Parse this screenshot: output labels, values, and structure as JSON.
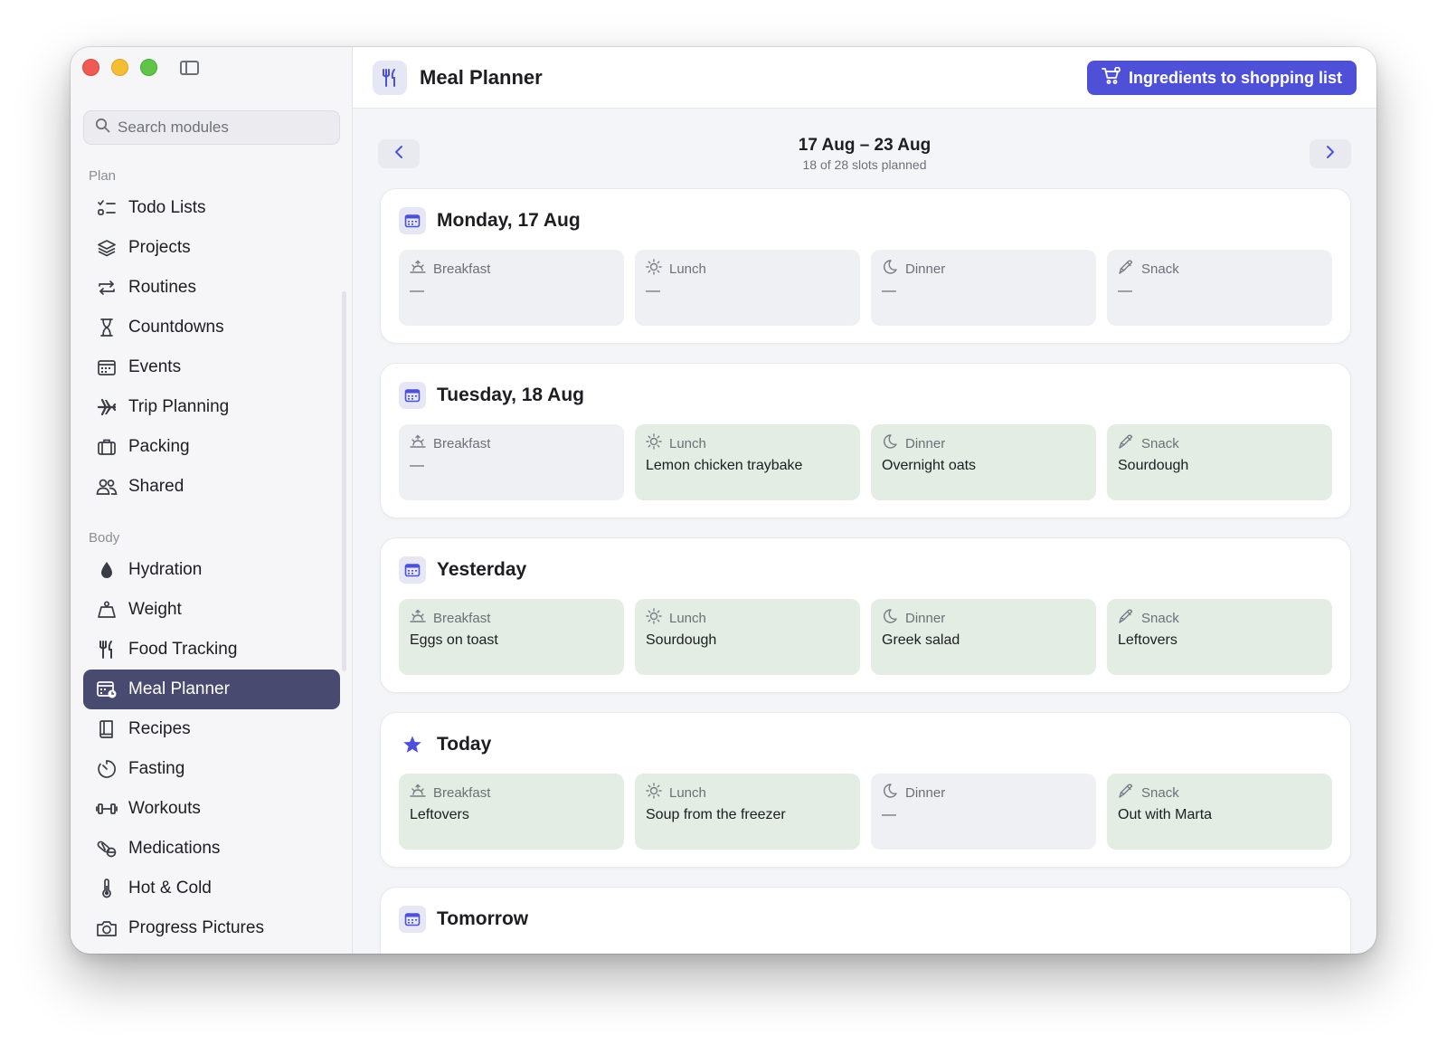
{
  "search": {
    "placeholder": "Search modules"
  },
  "sidebar": {
    "sections": [
      {
        "label": "Plan",
        "items": [
          {
            "label": "Todo Lists",
            "icon": "checklist-icon"
          },
          {
            "label": "Projects",
            "icon": "layers-icon"
          },
          {
            "label": "Routines",
            "icon": "repeat-icon"
          },
          {
            "label": "Countdowns",
            "icon": "hourglass-icon"
          },
          {
            "label": "Events",
            "icon": "calendar-icon"
          },
          {
            "label": "Trip Planning",
            "icon": "airplane-icon"
          },
          {
            "label": "Packing",
            "icon": "suitcase-icon"
          },
          {
            "label": "Shared",
            "icon": "people-icon"
          }
        ]
      },
      {
        "label": "Body",
        "items": [
          {
            "label": "Hydration",
            "icon": "droplet-icon"
          },
          {
            "label": "Weight",
            "icon": "scale-icon"
          },
          {
            "label": "Food Tracking",
            "icon": "fork-knife-icon"
          },
          {
            "label": "Meal Planner",
            "icon": "calendar-plan-icon",
            "active": true
          },
          {
            "label": "Recipes",
            "icon": "book-icon"
          },
          {
            "label": "Fasting",
            "icon": "timer-icon"
          },
          {
            "label": "Workouts",
            "icon": "dumbbell-icon"
          },
          {
            "label": "Medications",
            "icon": "pills-icon"
          },
          {
            "label": "Hot & Cold",
            "icon": "thermometer-icon"
          },
          {
            "label": "Progress Pictures",
            "icon": "camera-icon"
          }
        ]
      }
    ]
  },
  "header": {
    "title": "Meal Planner",
    "icon": "fork-knife-icon",
    "shopping_button": "Ingredients to shopping list"
  },
  "week": {
    "range": "17 Aug – 23 Aug",
    "summary": "18 of 28 slots planned"
  },
  "days": [
    {
      "title": "Monday, 17 Aug",
      "icon": "calendar-icon",
      "slots": [
        {
          "type": "Breakfast",
          "value": "—",
          "filled": false
        },
        {
          "type": "Lunch",
          "value": "—",
          "filled": false
        },
        {
          "type": "Dinner",
          "value": "—",
          "filled": false
        },
        {
          "type": "Snack",
          "value": "—",
          "filled": false
        }
      ]
    },
    {
      "title": "Tuesday, 18 Aug",
      "icon": "calendar-icon",
      "slots": [
        {
          "type": "Breakfast",
          "value": "—",
          "filled": false
        },
        {
          "type": "Lunch",
          "value": "Lemon chicken traybake",
          "filled": true
        },
        {
          "type": "Dinner",
          "value": "Overnight oats",
          "filled": true
        },
        {
          "type": "Snack",
          "value": "Sourdough",
          "filled": true
        }
      ]
    },
    {
      "title": "Yesterday",
      "icon": "calendar-icon",
      "slots": [
        {
          "type": "Breakfast",
          "value": "Eggs on toast",
          "filled": true
        },
        {
          "type": "Lunch",
          "value": "Sourdough",
          "filled": true
        },
        {
          "type": "Dinner",
          "value": "Greek salad",
          "filled": true
        },
        {
          "type": "Snack",
          "value": "Leftovers",
          "filled": true
        }
      ]
    },
    {
      "title": "Today",
      "icon": "star-icon",
      "slots": [
        {
          "type": "Breakfast",
          "value": "Leftovers",
          "filled": true
        },
        {
          "type": "Lunch",
          "value": "Soup from the freezer",
          "filled": true
        },
        {
          "type": "Dinner",
          "value": "—",
          "filled": false
        },
        {
          "type": "Snack",
          "value": "Out with Marta",
          "filled": true
        }
      ]
    },
    {
      "title": "Tomorrow",
      "icon": "calendar-icon",
      "slots": []
    }
  ],
  "colors": {
    "accent": "#4e51d8",
    "active_nav": "#484a70",
    "filled_slot": "#e3ede3",
    "empty_slot": "#eff0f4"
  }
}
